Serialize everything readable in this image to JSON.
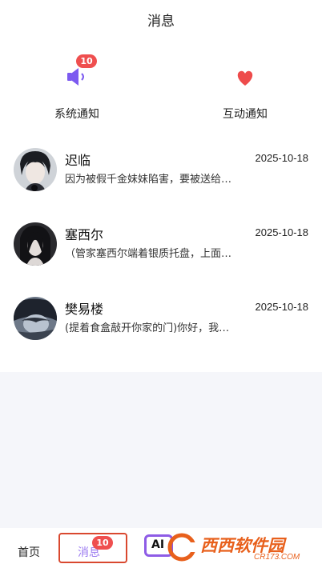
{
  "header": {
    "title": "消息"
  },
  "notices": {
    "system": {
      "label": "系统通知",
      "badge": "10",
      "icon": "speaker-icon",
      "color": "#7c5af0"
    },
    "interaction": {
      "label": "互动通知",
      "icon": "heart-icon",
      "color": "#ee4b4b"
    }
  },
  "messages": [
    {
      "name": "迟临",
      "date": "2025-10-18",
      "preview": "因为被假千金妹妹陷害，要被送给…"
    },
    {
      "name": "塞西尔",
      "date": "2025-10-18",
      "preview": "（管家塞西尔端着银质托盘，上面…"
    },
    {
      "name": "樊易楼",
      "date": "2025-10-18",
      "preview": "(提着食盒敲开你家的门)你好，我…"
    }
  ],
  "nav": {
    "home": "首页",
    "messages": "消息",
    "messages_badge": "10",
    "ai": "AI"
  },
  "watermark": {
    "text": "西西软件园",
    "url": "CR173.COM"
  }
}
